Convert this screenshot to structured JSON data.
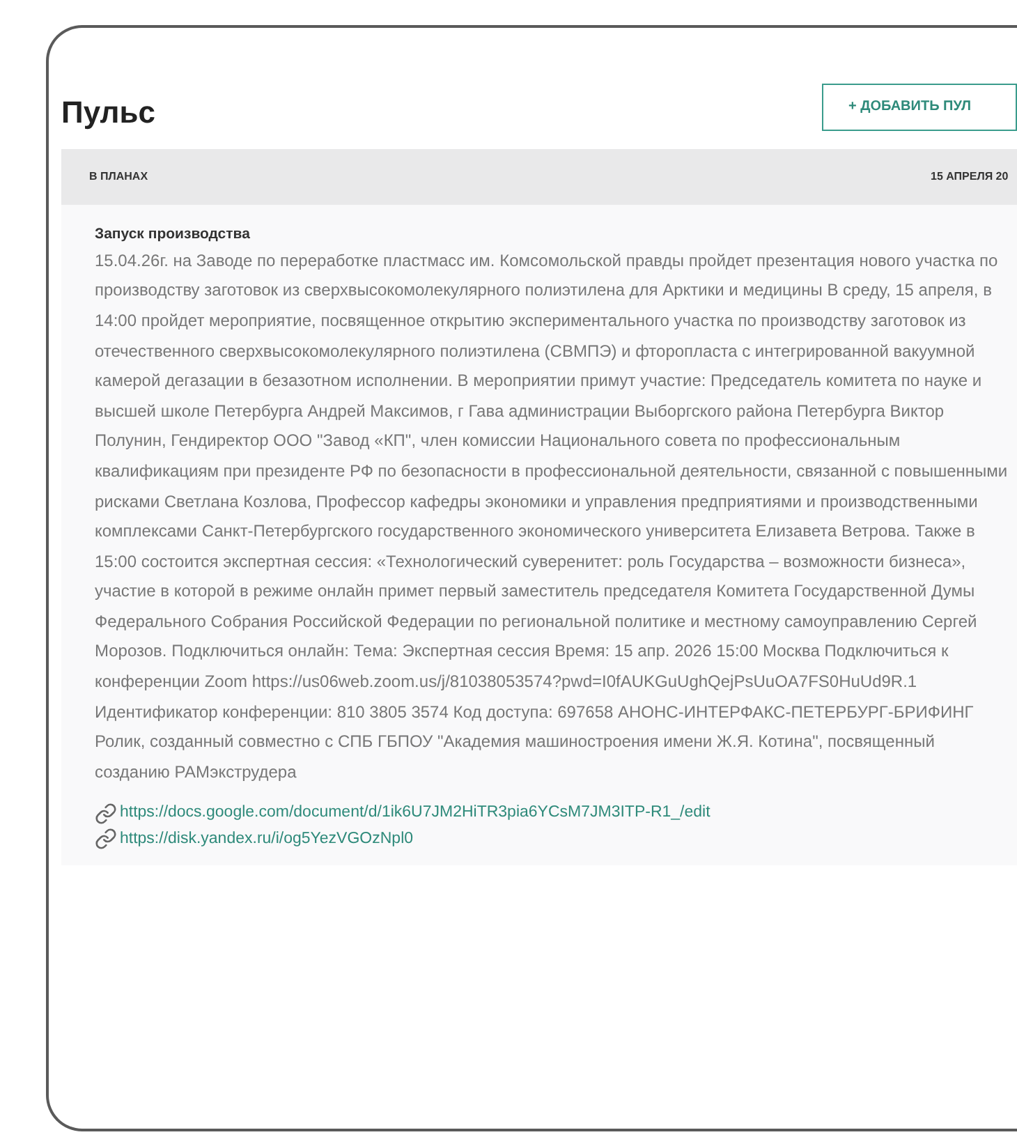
{
  "title": "Пульс",
  "add_button": {
    "label": "+ ДОБАВИТЬ ПУЛ"
  },
  "events": [
    {
      "status": "В ПЛАНАХ",
      "date": "15 АПРЕЛЯ 20",
      "heading": "Запуск производства",
      "body": "15.04.26г. на Заводе по переработке пластмасс им. Комсомольской правды пройдет презентация нового участка по производству заготовок из сверхвысокомолекулярного полиэтилена для Арктики и медицины В среду, 15 апреля, в 14:00 пройдет мероприятие, посвященное открытию экспериментального участка по производству заготовок из отечественного сверхвысокомолекулярного полиэтилена (СВМПЭ) и фторопласта с интегрированной вакуумной камерой дегазации в безазотном исполнении. В мероприятии примут участие: Председатель комитета по науке и высшей школе Петербурга Андрей Максимов, г Гава администрации Выборгского района Петербурга Виктор Полунин, Гендиректор ООО \"Завод «КП\", член комиссии Национального совета по профессиональным квалификациям при президенте РФ по безопасности в профессиональной деятельности, связанной с повышенными рисками Светлана Козлова, Профессор кафедры экономики и управления предприятиями и производственными комплексами Санкт-Петербургского государственного экономического университета Елизавета Ветрова. Также в 15:00 состоится экспертная сессия: «Технологический суверенитет: роль Государства – возможности бизнеса», участие в которой в режиме онлайн примет первый заместитель председателя Комитета Государственной Думы Федерального Собрания Российской Федерации по региональной политике и местному самоуправлению Сергей Морозов. Подключиться онлайн: Тема: Экспертная сессия Время: 15 апр. 2026 15:00 Москва Подключиться к конференции Zoom https://us06web.zoom.us/j/81038053574?pwd=I0fAUKGuUghQejPsUuOA7FS0HuUd9R.1 Идентификатор конференции: 810 3805 3574 Код доступа: 697658 АНОНС-ИНТЕРФАКС-ПЕТЕРБУРГ-БРИФИНГ Ролик, созданный совместно с СПБ ГБПОУ \"Академия машиностроения имени Ж.Я. Котина\", посвященный созданию РАМэкструдера",
      "links": [
        "https://docs.google.com/document/d/1ik6U7JM2HiTR3pia6YCsM7JM3ITP-R1_/edit",
        "https://disk.yandex.ru/i/og5YezVGOzNpl0"
      ]
    }
  ]
}
